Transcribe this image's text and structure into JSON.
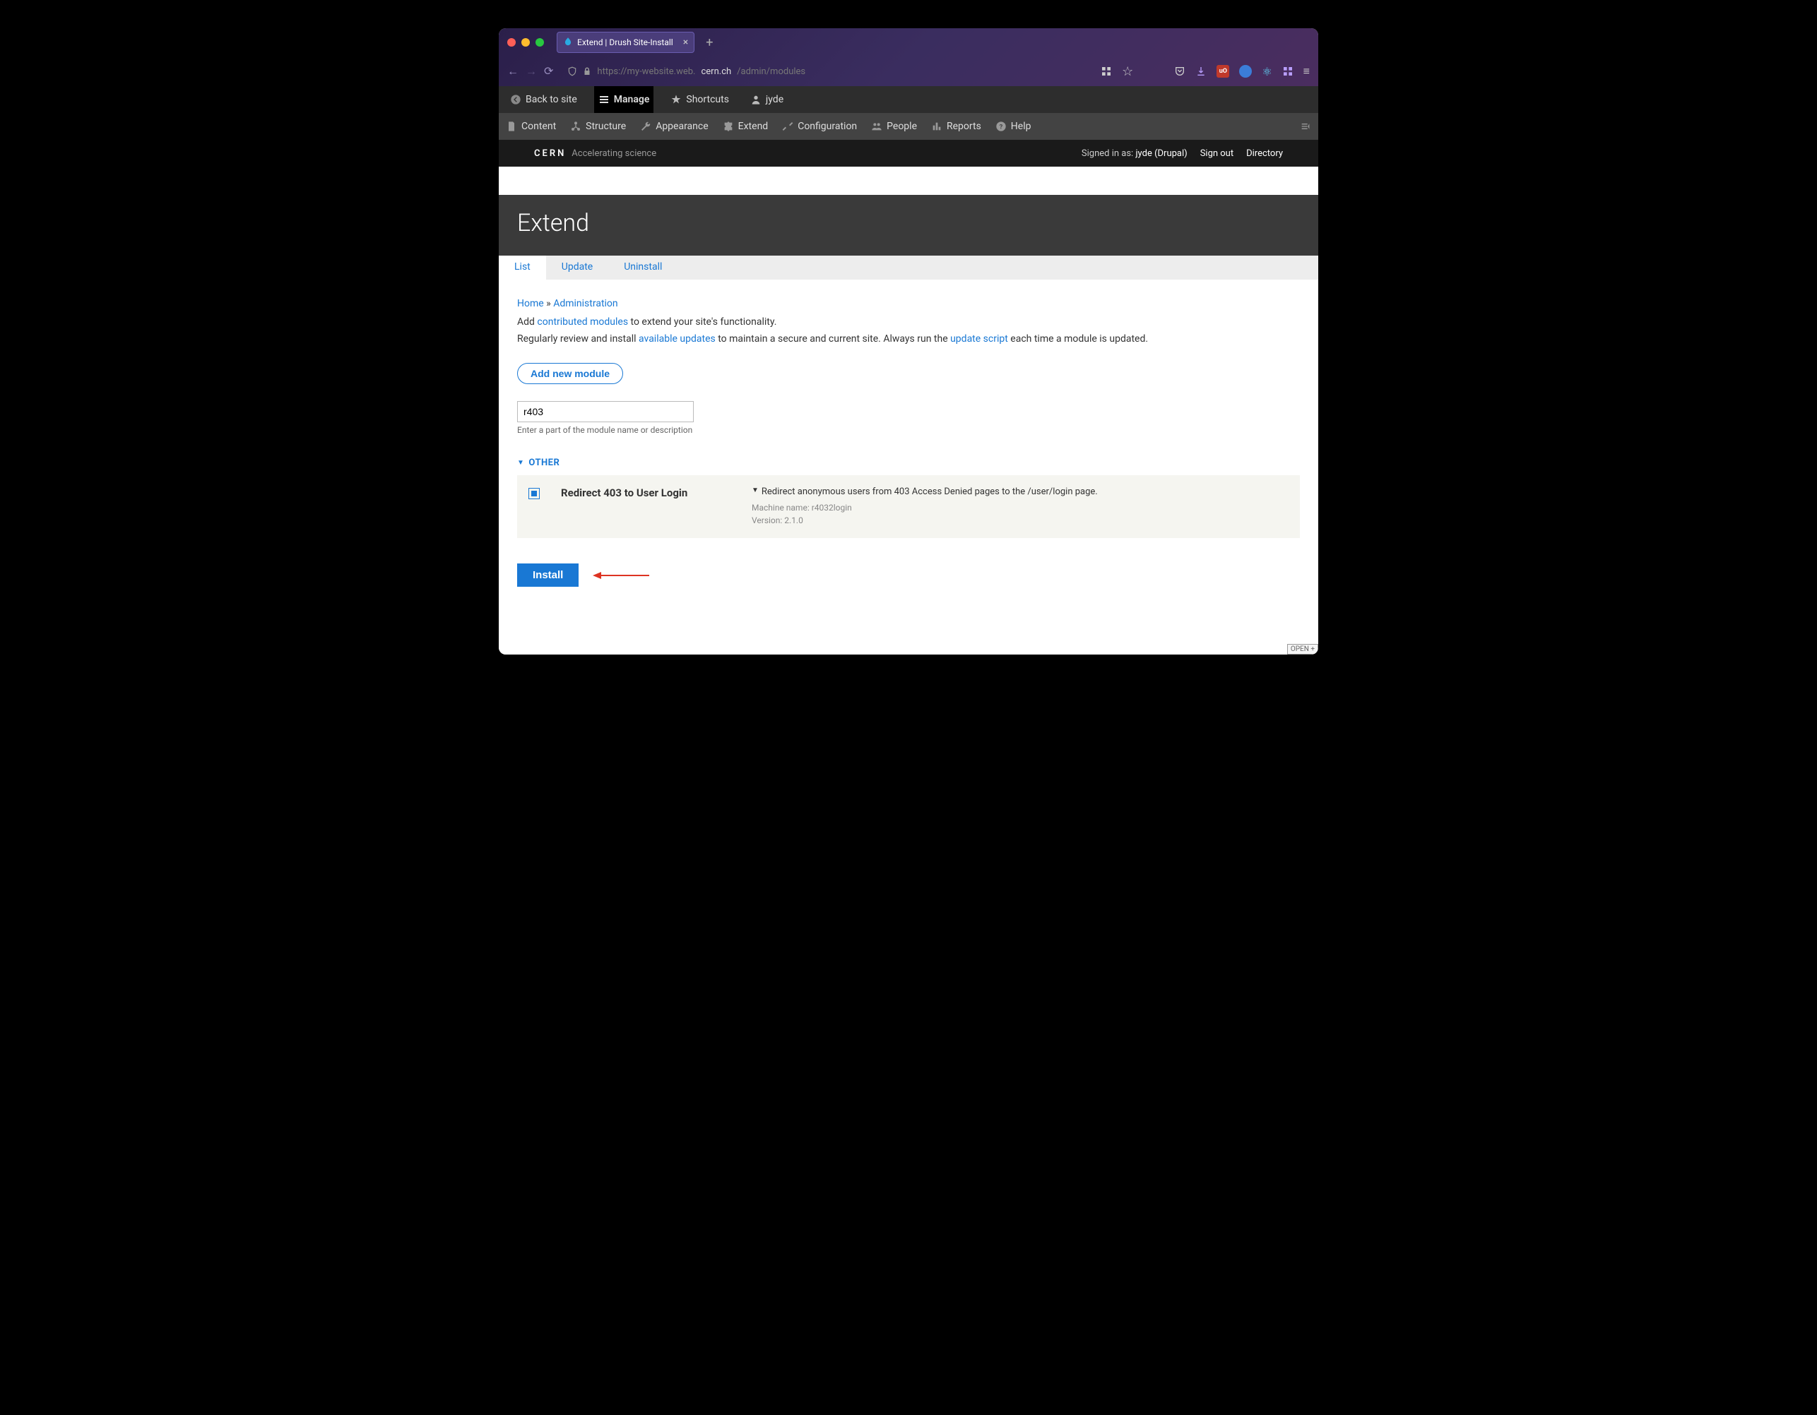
{
  "browser": {
    "tab_title": "Extend | Drush Site-Install",
    "url_prefix": "https://my-website.web.",
    "url_domain": "cern.ch",
    "url_path": "/admin/modules"
  },
  "toolbar1": {
    "back": "Back to site",
    "manage": "Manage",
    "shortcuts": "Shortcuts",
    "user": "jyde"
  },
  "toolbar2": {
    "content": "Content",
    "structure": "Structure",
    "appearance": "Appearance",
    "extend": "Extend",
    "configuration": "Configuration",
    "people": "People",
    "reports": "Reports",
    "help": "Help"
  },
  "cern": {
    "logo": "CERN",
    "tagline": "Accelerating science",
    "signed_in_prefix": "Signed in as:",
    "signed_in_user": "jyde (Drupal)",
    "sign_out": "Sign out",
    "directory": "Directory"
  },
  "page": {
    "title": "Extend"
  },
  "tabs": {
    "list": "List",
    "update": "Update",
    "uninstall": "Uninstall"
  },
  "breadcrumb": {
    "home": "Home",
    "sep": " » ",
    "admin": "Administration"
  },
  "help": {
    "line1a": "Add ",
    "line1_link": "contributed modules",
    "line1b": " to extend your site's functionality.",
    "line2a": "Regularly review and install ",
    "line2_link1": "available updates",
    "line2b": " to maintain a secure and current site. Always run the ",
    "line2_link2": "update script",
    "line2c": " each time a module is updated."
  },
  "add_button": "Add new module",
  "search": {
    "value": "r403",
    "hint": "Enter a part of the module name or description"
  },
  "section": "OTHER",
  "module": {
    "name": "Redirect 403 to User Login",
    "desc": "Redirect anonymous users from 403 Access Denied pages to the /user/login page.",
    "machine_label": "Machine name: ",
    "machine": "r4032login",
    "version_label": "Version: ",
    "version": "2.1.0"
  },
  "install": "Install",
  "open_badge": "OPEN +"
}
